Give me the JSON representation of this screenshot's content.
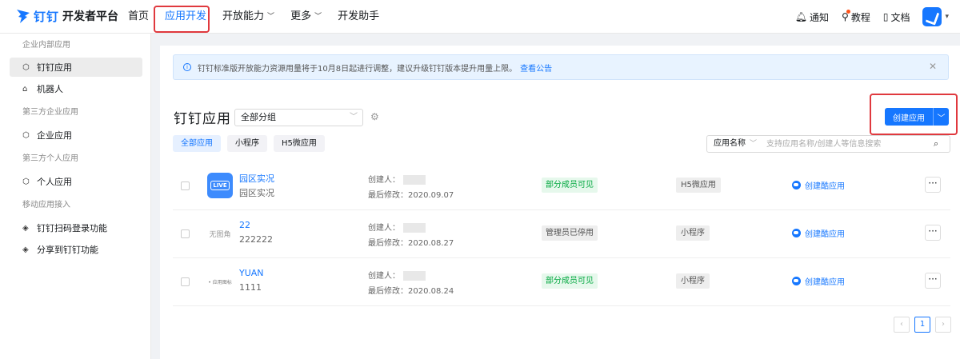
{
  "header": {
    "logo_text": "钉钉",
    "logo_sub": "开发者平台",
    "nav": [
      {
        "label": "首页",
        "dropdown": false
      },
      {
        "label": "应用开发",
        "dropdown": false,
        "active": true
      },
      {
        "label": "开放能力",
        "dropdown": true
      },
      {
        "label": "更多",
        "dropdown": true
      },
      {
        "label": "开发助手",
        "dropdown": false
      }
    ],
    "right": {
      "notice": "通知",
      "tutorial": "教程",
      "docs": "文档"
    }
  },
  "sidebar": {
    "groups": [
      {
        "title": "企业内部应用",
        "items": [
          {
            "label": "钉钉应用",
            "icon": "cube-icon",
            "active": true
          },
          {
            "label": "机器人",
            "icon": "robot-icon"
          }
        ]
      },
      {
        "title": "第三方企业应用",
        "items": [
          {
            "label": "企业应用",
            "icon": "cube-icon"
          }
        ]
      },
      {
        "title": "第三方个人应用",
        "items": [
          {
            "label": "个人应用",
            "icon": "cube-icon"
          }
        ]
      },
      {
        "title": "移动应用接入",
        "items": [
          {
            "label": "钉钉扫码登录功能",
            "icon": "diamond-icon"
          },
          {
            "label": "分享到钉钉功能",
            "icon": "diamond-icon"
          }
        ]
      }
    ]
  },
  "notice": {
    "text": "钉钉标准版开放能力资源用量将于10月8日起进行调整，建议升级钉钉版本提升用量上限。",
    "link": "查看公告"
  },
  "main": {
    "title": "钉钉应用",
    "group_select": "全部分组",
    "create_button": "创建应用",
    "tabs": [
      "全部应用",
      "小程序",
      "H5微应用"
    ],
    "search_field": "应用名称",
    "search_placeholder": "支持应用名称/创建人等信息搜索"
  },
  "apps": [
    {
      "icon": "LIVE",
      "icon_kind": "live",
      "name": "园区实况",
      "desc": "园区实况",
      "creator_label": "创建人：",
      "modified": "最后修改：2020.09.07",
      "status": "部分成员可见",
      "status_color": "green",
      "type": "H5微应用",
      "action": "创建酷应用"
    },
    {
      "icon": "无图角",
      "icon_kind": "txt",
      "name": "22",
      "desc": "222222",
      "creator_label": "创建人：",
      "modified": "最后修改：2020.08.27",
      "status": "管理员已停用",
      "status_color": "gray",
      "type": "小程序",
      "action": "创建酷应用"
    },
    {
      "icon": "• 应用图标",
      "icon_kind": "tiny",
      "name": "YUAN",
      "desc": "1111",
      "creator_label": "创建人：",
      "modified": "最后修改：2020.08.24",
      "status": "部分成员可见",
      "status_color": "green",
      "type": "小程序",
      "action": "创建酷应用"
    }
  ],
  "pagination": {
    "current": "1",
    "prev": "‹",
    "next": "›"
  },
  "colors": {
    "accent": "#1677ff",
    "highlight": "#e0393e"
  }
}
